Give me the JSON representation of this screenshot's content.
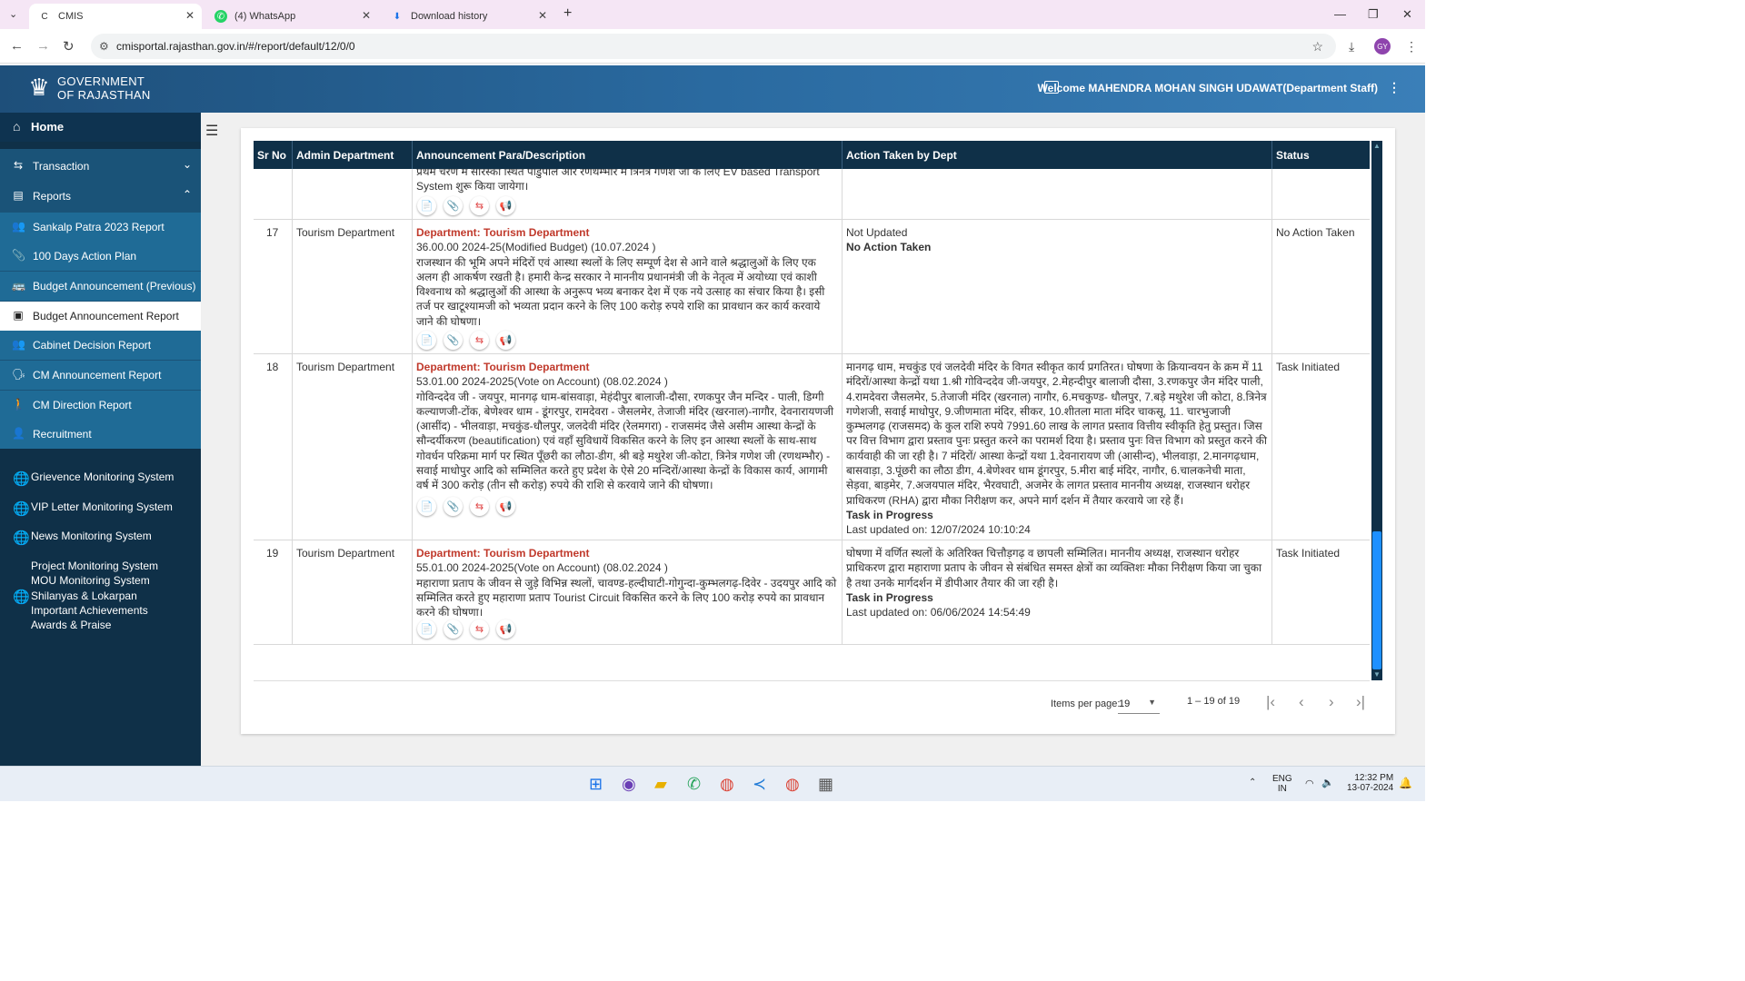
{
  "browser": {
    "tabs": [
      {
        "title": "CMIS",
        "active": true
      },
      {
        "title": "(4) WhatsApp",
        "active": false
      },
      {
        "title": "Download history",
        "active": false
      }
    ],
    "url": "cmisportal.rajasthan.gov.in/#/report/default/12/0/0",
    "profile_initials": "GY"
  },
  "header": {
    "logo_line1": "GOVERNMENT",
    "logo_line2": "OF RAJASTHAN",
    "welcome": "Welcome MAHENDRA MOHAN SINGH UDAWAT(Department Staff)"
  },
  "sidebar": {
    "home": "Home",
    "transaction": "Transaction",
    "reports": "Reports",
    "report_items": [
      "Sankalp Patra 2023 Report",
      "100 Days Action Plan",
      "Budget Announcement (Previous)",
      "Budget Announcement Report",
      "Cabinet Decision Report",
      "CM Announcement Report",
      "CM Direction Report",
      "Recruitment"
    ],
    "systems": [
      "Grievence Monitoring System",
      "VIP Letter Monitoring System",
      "News Monitoring System"
    ],
    "plain_items": [
      "Project Monitoring System",
      "MOU Monitoring System",
      "Shilanyas & Lokarpan",
      "Important Achievements",
      "Awards & Praise"
    ]
  },
  "table": {
    "headers": {
      "srno": "Sr No",
      "admin": "Admin Department",
      "announcement": "Announcement Para/Description",
      "action": "Action Taken by Dept",
      "status": "Status"
    },
    "partial_row": {
      "line1": "प्रथम चरण में सारस्का स्थित पाडुपोल और रणथम्भौर में त्रिनेत्र गणेश जी के लिए EV based Transport",
      "line2": "System शुरू किया जायेगा।"
    },
    "rows": [
      {
        "srno": "17",
        "admin": "Tourism Department",
        "dept_label": "Department: Tourism Department",
        "meta": "36.00.00   2024-25(Modified Budget)  (10.07.2024 )",
        "description": "राजस्थान की भूमि अपने मंदिरों एवं आस्था स्थलों के लिए सम्पूर्ण देश से आने वाले श्रद्धालुओं के लिए एक अलग ही आकर्षण रखती है। हमारी केन्द्र सरकार ने माननीय प्रधानमंत्री जी के नेतृत्व में अयोध्या एवं काशी विश्वनाथ को श्रद्धालुओं की आस्था के अनुरूप भव्य बनाकर देश में एक नये उत्साह का संचार किया है। इसी तर्ज पर खाटूश्यामजी को भव्यता प्रदान करने के लिए 100 करोड़ रुपये राशि का प्रावधान कर कार्य करवाये जाने की घोषणा।",
        "action_text": "Not Updated",
        "action_status": "No Action Taken",
        "last_updated": "",
        "status": "No Action Taken"
      },
      {
        "srno": "18",
        "admin": "Tourism Department",
        "dept_label": "Department: Tourism Department",
        "meta": "53.01.00   2024-2025(Vote on Account)  (08.02.2024 )",
        "description": "गोविन्ददेव जी - जयपुर, मानगढ़ धाम-बांसवाड़ा, मेहंदीपुर बालाजी-दौसा, रणकपुर जैन मन्दिर - पाली, डिग्गी कल्याणजी-टोंक, बेणेश्वर धाम - डूंगरपुर, रामदेवरा - जैसलमेर, तेजाजी मंदिर (खरनाल)-नागौर, देवनारायणजी (आसींद) - भीलवाड़ा, मचकुंड-धौलपुर, जलदेवी मंदिर (रेलमगरा) - राजसमंद जैसे असीम आस्था केन्द्रों के सौन्दर्यीकरण (beautification) एवं वहाँ सुविधायें विकसित करने के लिए इन आस्था स्थलों के साथ-साथ गोवर्धन परिक्रमा मार्ग पर स्थित पूँछरी का लौठा-डीग, श्री बड़े मथुरेश जी-कोटा, त्रिनेत्र गणेश जी (रणथम्भौर) - सवाई माधोपुर आदि को सम्मिलित करते हुए प्रदेश के ऐसे 20 मन्दिरों/आस्था केन्द्रों के विकास कार्य, आगामी वर्ष में 300 करोड़ (तीन सौ करोड़) रुपये की राशि से करवाये जाने की घोषणा।",
        "action_text": "मानगढ़ धाम, मचकुंड एवं जलदेवी मंदिर के विगत स्वीकृत कार्य प्रगतिरत। घोषणा के क्रियान्वयन के क्रम में 11 मंदिरों/आस्था केन्द्रों यथा 1.श्री गोविन्ददेव जी-जयपुर, 2.मेहन्दीपुर बालाजी दौसा, 3.रणकपुर जैन मंदिर पाली, 4.रामदेवरा जैसलमेर, 5.तेजाजी मंदिर (खरनाल) नागौर, 6.मचकुण्ड- धौलपुर, 7.बड़े मथुरेश जी कोटा, 8.त्रिनेत्र गणेशजी, सवाई माधोपुर, 9.जीणमाता मंदिर, सीकर, 10.शीतला माता मंदिर चाकसू, 11. चारभुजाजी कुम्भलगढ़ (राजसमद) के कुल राशि रुपये 7991.60 लाख के लागत प्रस्ताव वित्तीय स्वीकृति हेतु प्रस्तुत। जिस पर वित्त विभाग द्वारा प्रस्ताव पुनः प्रस्तुत करने का परामर्श दिया है। प्रस्ताव पुनः वित्त विभाग को प्रस्तुत करने की कार्यवाही की जा रही है। 7 मंदिरों/ आस्था केन्द्रों यथा 1.देवनारायण जी (आसीन्द), भीलवाड़ा, 2.मानगढ़धाम, बासवाड़ा, 3.पूंछरी का लौठा डीग, 4.बेणेश्वर धाम डूंगरपुर, 5.मीरा बाई मंदिर, नागौर, 6.चालकनेची माता, सेड़वा, बाड़मेर, 7.अजयपाल मंदिर, भैरवघाटी, अजमेर के लागत प्रस्ताव माननीय अध्यक्ष, राजस्थान धरोहर प्राधिकरण (RHA) द्वारा मौका निरीक्षण कर, अपने मार्ग दर्शन में तैयार करवाये जा रहे हैं।",
        "action_status": "Task in Progress",
        "last_updated": "Last updated on: 12/07/2024 10:10:24",
        "status": "Task Initiated"
      },
      {
        "srno": "19",
        "admin": "Tourism Department",
        "dept_label": "Department: Tourism Department",
        "meta": "55.01.00   2024-2025(Vote on Account)  (08.02.2024 )",
        "description": "महाराणा प्रताप के जीवन से जुड़े विभिन्न स्थलों, चावण्ड-हल्दीघाटी-गोगुन्दा-कुम्भलगढ़-दिवेर - उदयपुर आदि को सम्मिलित करते हुए महाराणा प्रताप Tourist Circuit विकसित करने के लिए 100 करोड़ रुपये का प्रावधान करने की घोषणा।",
        "action_text": "घोषणा में वर्णित स्थलों के अतिरिक्त चित्तौड़गढ़ व छापली सम्मिलित। माननीय अध्यक्ष, राजस्थान धरोहर प्राधिकरण द्वारा महाराणा प्रताप के जीवन से संबंधित समस्त क्षेत्रों का व्यक्तिशः मौका निरीक्षण किया जा चुका है तथा उनके मार्गदर्शन में डीपीआर तैयार की जा रही है।",
        "action_status": "Task in Progress",
        "last_updated": "Last updated on: 06/06/2024 14:54:49",
        "status": "Task Initiated"
      }
    ]
  },
  "pagination": {
    "items_per_page_label": "Items per page:",
    "items_per_page": "19",
    "range": "1 – 19 of 19"
  },
  "taskbar": {
    "lang1": "ENG",
    "lang2": "IN",
    "time": "12:32 PM",
    "date": "13-07-2024"
  }
}
